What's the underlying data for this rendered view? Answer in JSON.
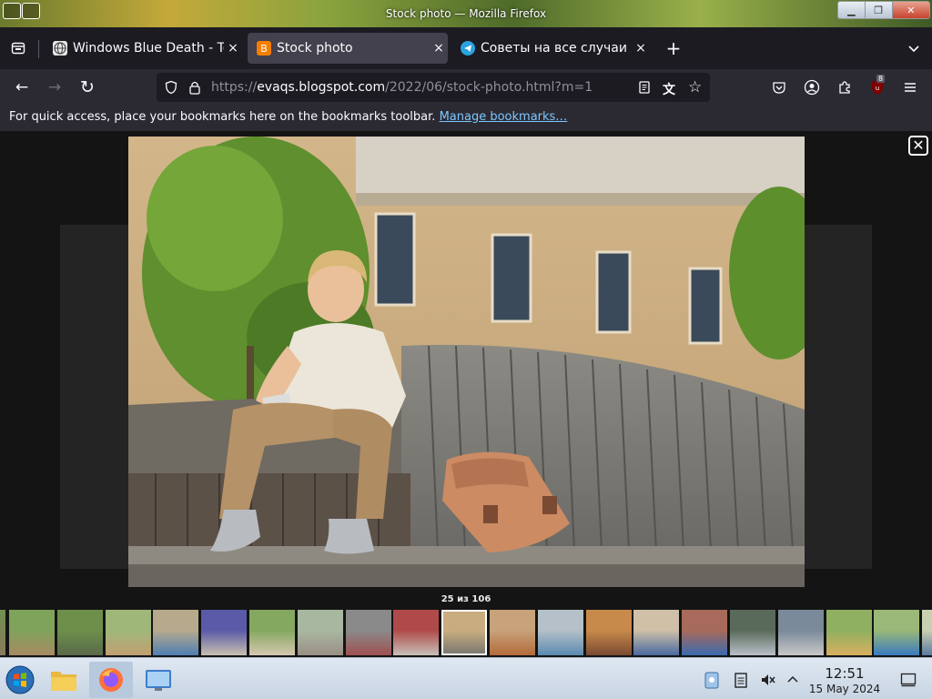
{
  "window": {
    "title": "Stock photo — Mozilla Firefox"
  },
  "tabs": [
    {
      "label": "Windows Blue Death - Te",
      "close": "×",
      "favicon": "globe-icon",
      "active": false
    },
    {
      "label": "Stock photo",
      "close": "×",
      "favicon": "blogger-icon",
      "active": true
    },
    {
      "label": "Советы на все случаи ж",
      "close": "×",
      "favicon": "telegram-icon",
      "active": false
    }
  ],
  "tabstrip": {
    "new_tab": "+",
    "list_all": "⌄"
  },
  "navbar": {
    "back": "←",
    "forward": "→",
    "reload": "↻",
    "url_prefix": "https://",
    "url_host": "evaqs.blogspot.com",
    "url_path": "/2022/06/stock-photo.html?m=1",
    "extension_badge": "8"
  },
  "bookmarks": {
    "message": "For quick access, place your bookmarks here on the bookmarks toolbar.",
    "link": "Manage bookmarks…"
  },
  "lightbox": {
    "close": "✕",
    "counter": "25 из 106",
    "thumbnail_count": 20,
    "selected_thumbnail": 9
  },
  "taskbar": {
    "time": "12:51",
    "date": "15 May 2024"
  }
}
